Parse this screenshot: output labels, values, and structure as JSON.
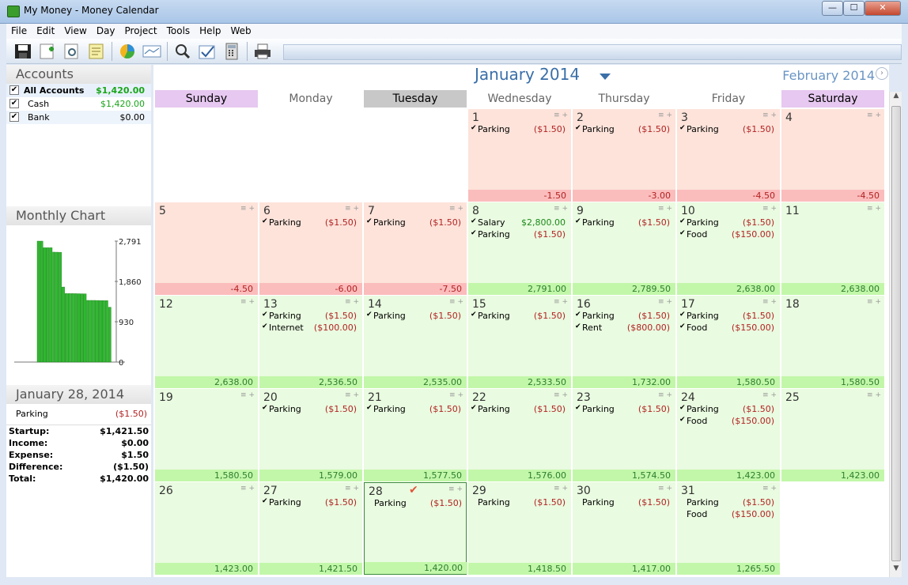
{
  "window": {
    "title": "My Money - Money Calendar",
    "minimize": "—",
    "maximize": "☐",
    "close": "✕"
  },
  "menu": [
    "File",
    "Edit",
    "View",
    "Day",
    "Project",
    "Tools",
    "Help",
    "Web"
  ],
  "toolbar": [
    "save-icon",
    "new-entry-icon",
    "preview-icon",
    "notes-icon",
    "pie-chart-icon",
    "line-chart-icon",
    "search-icon",
    "reconcile-icon",
    "calculator-icon",
    "print-icon"
  ],
  "accounts": {
    "title": "Accounts",
    "items": [
      {
        "name": "All Accounts",
        "balance": "$1,420.00"
      },
      {
        "name": "Cash",
        "balance": "$1,420.00"
      },
      {
        "name": "Bank",
        "balance": "$0.00"
      }
    ]
  },
  "monthly_chart": {
    "title": "Monthly Chart",
    "chart_data": {
      "type": "bar",
      "title": "",
      "y_ticks": [
        "2,791",
        "1,860",
        "930",
        "0"
      ],
      "ylim": [
        0,
        2791
      ],
      "values": [
        2791,
        2791,
        2638,
        2638,
        2638,
        2536.5,
        2535,
        2533.5,
        1732,
        1580.5,
        1580.5,
        1580.5,
        1579,
        1577.5,
        1576,
        1574.5,
        1423,
        1423,
        1423,
        1421.5,
        1420,
        1418.5,
        1417,
        1265.5
      ],
      "grid": false
    }
  },
  "selected_day": {
    "title": "January 28, 2014",
    "entries": [
      {
        "name": "Parking",
        "amount": "($1.50)"
      }
    ],
    "summary": [
      {
        "label": "Startup:",
        "value": "$1,421.50"
      },
      {
        "label": "Income:",
        "value": "$0.00"
      },
      {
        "label": "Expense:",
        "value": "$1.50"
      },
      {
        "label": "Difference:",
        "value": "($1.50)"
      },
      {
        "label": "Total:",
        "value": "$1,420.00"
      }
    ]
  },
  "calendar": {
    "month": "January 2014",
    "next_month": "February 2014",
    "weekdays": [
      "Sunday",
      "Monday",
      "Tuesday",
      "Wednesday",
      "Thursday",
      "Friday",
      "Saturday"
    ],
    "days": [
      {
        "d": "1",
        "total": "-1.50",
        "tx": [
          {
            "n": "Parking",
            "a": "($1.50)",
            "c": true
          }
        ]
      },
      {
        "d": "2",
        "total": "-3.00",
        "tx": [
          {
            "n": "Parking",
            "a": "($1.50)",
            "c": true
          }
        ]
      },
      {
        "d": "3",
        "total": "-4.50",
        "tx": [
          {
            "n": "Parking",
            "a": "($1.50)",
            "c": true
          }
        ]
      },
      {
        "d": "4",
        "total": "-4.50",
        "tx": []
      },
      {
        "d": "5",
        "total": "-4.50",
        "tx": []
      },
      {
        "d": "6",
        "total": "-6.00",
        "tx": [
          {
            "n": "Parking",
            "a": "($1.50)",
            "c": true
          }
        ]
      },
      {
        "d": "7",
        "total": "-7.50",
        "tx": [
          {
            "n": "Parking",
            "a": "($1.50)",
            "c": true
          }
        ]
      },
      {
        "d": "8",
        "total": "2,791.00",
        "tx": [
          {
            "n": "Salary",
            "a": "$2,800.00",
            "c": true,
            "inc": true
          },
          {
            "n": "Parking",
            "a": "($1.50)",
            "c": true
          }
        ]
      },
      {
        "d": "9",
        "total": "2,789.50",
        "tx": [
          {
            "n": "Parking",
            "a": "($1.50)",
            "c": true
          }
        ]
      },
      {
        "d": "10",
        "total": "2,638.00",
        "tx": [
          {
            "n": "Parking",
            "a": "($1.50)",
            "c": true
          },
          {
            "n": "Food",
            "a": "($150.00)",
            "c": true
          }
        ]
      },
      {
        "d": "11",
        "total": "2,638.00",
        "tx": []
      },
      {
        "d": "12",
        "total": "2,638.00",
        "tx": []
      },
      {
        "d": "13",
        "total": "2,536.50",
        "tx": [
          {
            "n": "Parking",
            "a": "($1.50)",
            "c": true
          },
          {
            "n": "Internet",
            "a": "($100.00)",
            "c": true
          }
        ]
      },
      {
        "d": "14",
        "total": "2,535.00",
        "tx": [
          {
            "n": "Parking",
            "a": "($1.50)",
            "c": true
          }
        ]
      },
      {
        "d": "15",
        "total": "2,533.50",
        "tx": [
          {
            "n": "Parking",
            "a": "($1.50)",
            "c": true
          }
        ]
      },
      {
        "d": "16",
        "total": "1,732.00",
        "tx": [
          {
            "n": "Parking",
            "a": "($1.50)",
            "c": true
          },
          {
            "n": "Rent",
            "a": "($800.00)",
            "c": true
          }
        ]
      },
      {
        "d": "17",
        "total": "1,580.50",
        "tx": [
          {
            "n": "Parking",
            "a": "($1.50)",
            "c": true
          },
          {
            "n": "Food",
            "a": "($150.00)",
            "c": true
          }
        ]
      },
      {
        "d": "18",
        "total": "1,580.50",
        "tx": []
      },
      {
        "d": "19",
        "total": "1,580.50",
        "tx": []
      },
      {
        "d": "20",
        "total": "1,579.00",
        "tx": [
          {
            "n": "Parking",
            "a": "($1.50)",
            "c": true
          }
        ]
      },
      {
        "d": "21",
        "total": "1,577.50",
        "tx": [
          {
            "n": "Parking",
            "a": "($1.50)",
            "c": true
          }
        ]
      },
      {
        "d": "22",
        "total": "1,576.00",
        "tx": [
          {
            "n": "Parking",
            "a": "($1.50)",
            "c": true
          }
        ]
      },
      {
        "d": "23",
        "total": "1,574.50",
        "tx": [
          {
            "n": "Parking",
            "a": "($1.50)",
            "c": true
          }
        ]
      },
      {
        "d": "24",
        "total": "1,423.00",
        "tx": [
          {
            "n": "Parking",
            "a": "($1.50)",
            "c": true
          },
          {
            "n": "Food",
            "a": "($150.00)",
            "c": true
          }
        ]
      },
      {
        "d": "25",
        "total": "1,423.00",
        "tx": []
      },
      {
        "d": "26",
        "total": "1,423.00",
        "tx": []
      },
      {
        "d": "27",
        "total": "1,421.50",
        "tx": [
          {
            "n": "Parking",
            "a": "($1.50)",
            "c": true
          }
        ]
      },
      {
        "d": "28",
        "total": "1,420.00",
        "tx": [
          {
            "n": "Parking",
            "a": "($1.50)",
            "c": false
          }
        ]
      },
      {
        "d": "29",
        "total": "1,418.50",
        "tx": [
          {
            "n": "Parking",
            "a": "($1.50)",
            "c": false
          }
        ]
      },
      {
        "d": "30",
        "total": "1,417.00",
        "tx": [
          {
            "n": "Parking",
            "a": "($1.50)",
            "c": false
          }
        ]
      },
      {
        "d": "31",
        "total": "1,265.50",
        "tx": [
          {
            "n": "Parking",
            "a": "($1.50)",
            "c": false
          },
          {
            "n": "Food",
            "a": "($150.00)",
            "c": false
          }
        ]
      }
    ],
    "colors": {
      "negative_bg": "#fde3da",
      "negative_total": "#fbbcbc",
      "positive_bg": "#e9fbe0",
      "positive_total": "#c2f7a9",
      "sunday_hdr": "#e6c8f0",
      "saturday_hdr": "#e6c8f0",
      "tuesday_hdr": "#c8c8c8"
    }
  }
}
